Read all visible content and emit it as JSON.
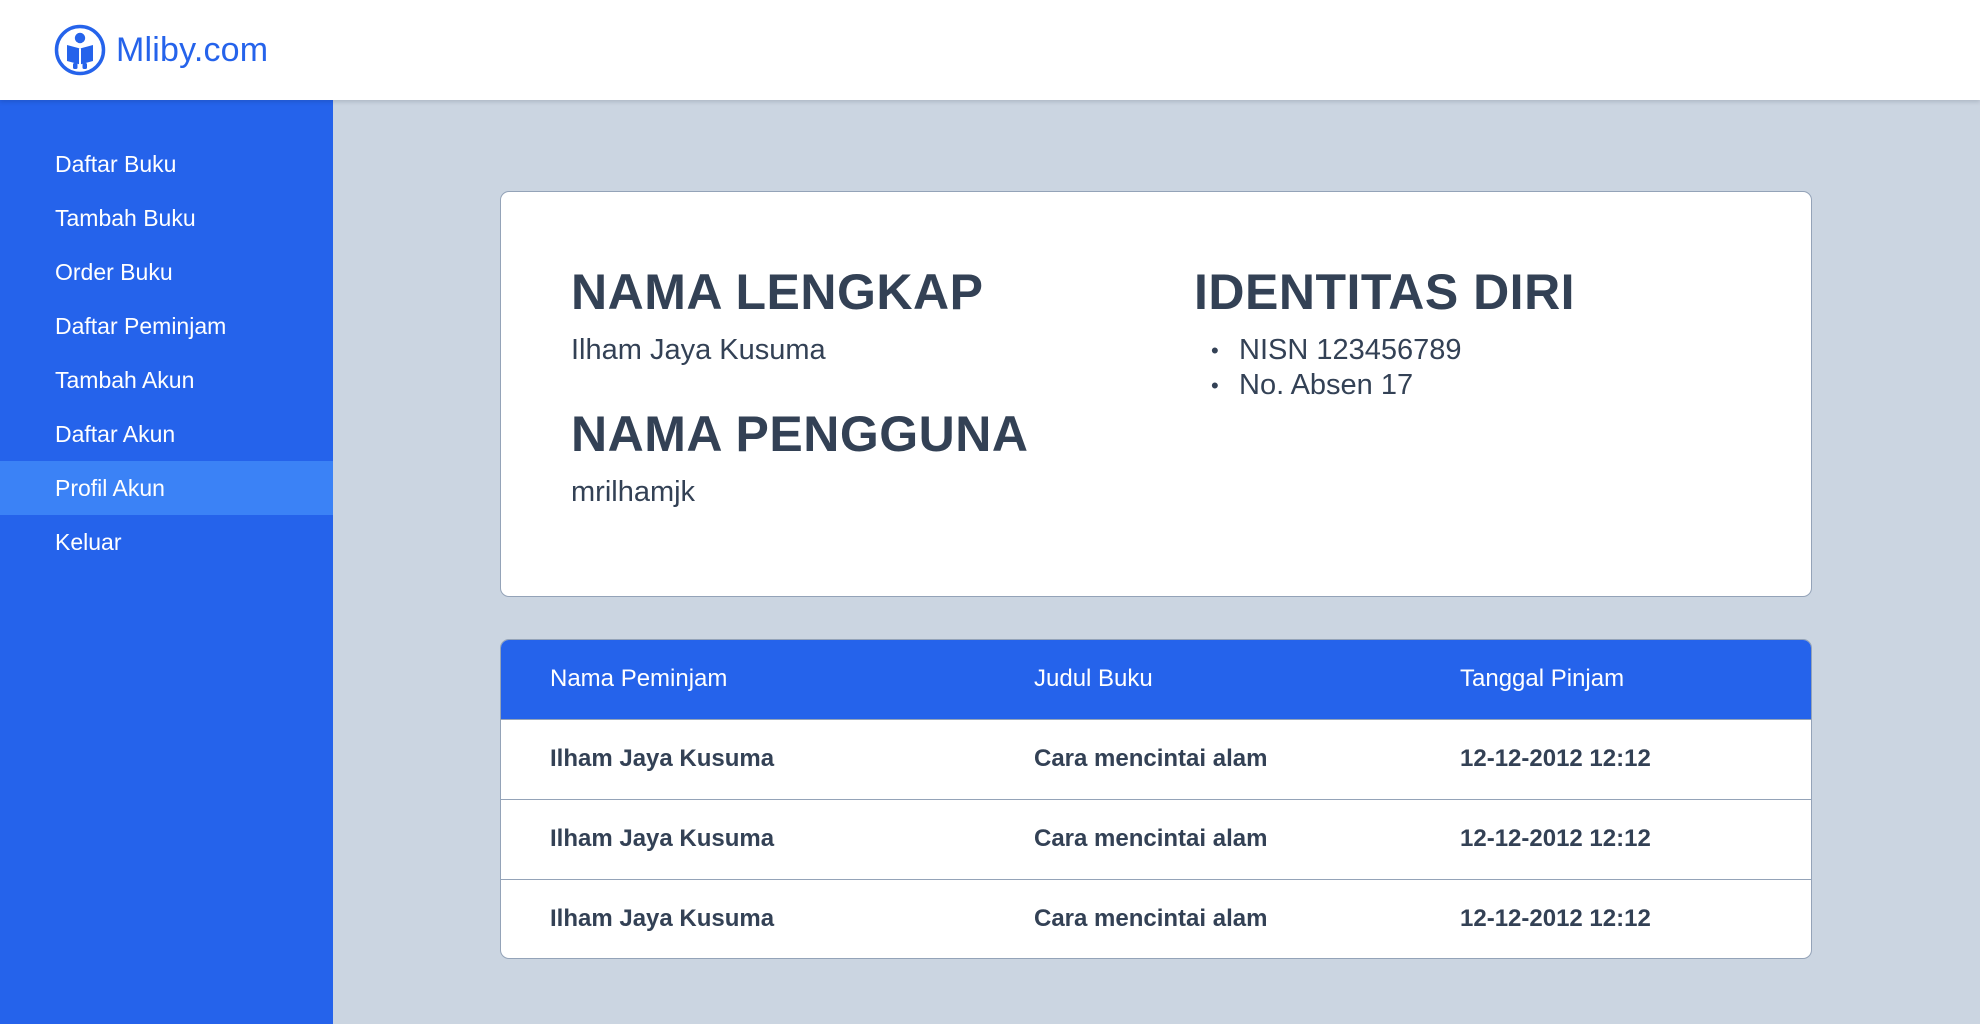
{
  "brand": {
    "name": "Mliby.com",
    "icon": "reading-person-icon",
    "color": "#2563eb"
  },
  "sidebar": {
    "items": [
      {
        "label": "Daftar Buku",
        "active": false
      },
      {
        "label": "Tambah Buku",
        "active": false
      },
      {
        "label": "Order Buku",
        "active": false
      },
      {
        "label": "Daftar Peminjam",
        "active": false
      },
      {
        "label": "Tambah Akun",
        "active": false
      },
      {
        "label": "Daftar Akun",
        "active": false
      },
      {
        "label": "Profil Akun",
        "active": true
      },
      {
        "label": "Keluar",
        "active": false
      }
    ]
  },
  "profile": {
    "full_name_heading": "NAMA LENGKAP",
    "full_name": "Ilham Jaya Kusuma",
    "username_heading": "NAMA PENGGUNA",
    "username": "mrilhamjk",
    "identity_heading": "IDENTITAS DIRI",
    "identity_items": [
      "NISN 123456789",
      "No. Absen 17"
    ]
  },
  "loans_table": {
    "headers": [
      "Nama Peminjam",
      "Judul Buku",
      "Tanggal Pinjam"
    ],
    "rows": [
      [
        "Ilham Jaya Kusuma",
        "Cara mencintai alam",
        "12-12-2012 12:12"
      ],
      [
        "Ilham Jaya Kusuma",
        "Cara mencintai alam",
        "12-12-2012 12:12"
      ],
      [
        "Ilham Jaya Kusuma",
        "Cara mencintai alam",
        "12-12-2012 12:12"
      ]
    ]
  },
  "colors": {
    "primary": "#2563eb",
    "active_item": "#3b82f6",
    "background": "#cbd5e1",
    "text": "#334155"
  }
}
